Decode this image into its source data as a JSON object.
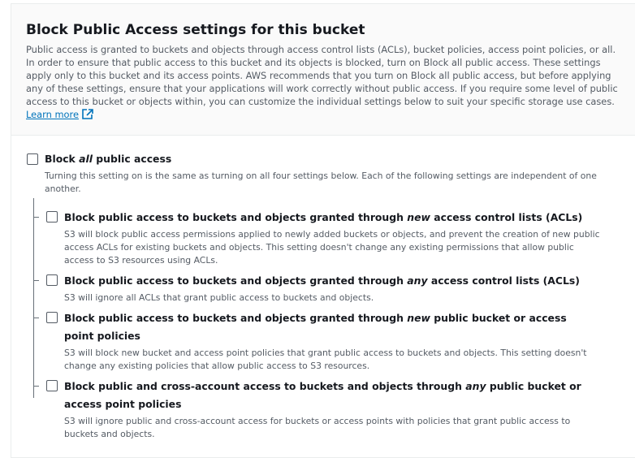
{
  "section": {
    "title": "Block Public Access settings for this bucket",
    "description": "Public access is granted to buckets and objects through access control lists (ACLs), bucket policies, access point policies, or all. In order to ensure that public access to this bucket and its objects is blocked, turn on Block all public access. These settings apply only to this bucket and its access points. AWS recommends that you turn on Block all public access, but before applying any of these settings, ensure that your applications will work correctly without public access. If you require some level of public access to this bucket or objects within, you can customize the individual settings below to suit your specific storage use cases.",
    "learn_more": "Learn more"
  },
  "block_all": {
    "label_pre": "Block ",
    "label_em": "all",
    "label_post": " public access",
    "description": "Turning this setting on is the same as turning on all four settings below. Each of the following settings are independent of one another.",
    "checked": false
  },
  "options": [
    {
      "label_pre": "Block public access to buckets and objects granted through ",
      "label_em": "new",
      "label_post": " access control lists (ACLs)",
      "description": "S3 will block public access permissions applied to newly added buckets or objects, and prevent the creation of new public access ACLs for existing buckets and objects. This setting doesn't change any existing permissions that allow public access to S3 resources using ACLs.",
      "checked": false
    },
    {
      "label_pre": "Block public access to buckets and objects granted through ",
      "label_em": "any",
      "label_post": " access control lists (ACLs)",
      "description": "S3 will ignore all ACLs that grant public access to buckets and objects.",
      "checked": false
    },
    {
      "label_pre": "Block public access to buckets and objects granted through ",
      "label_em": "new",
      "label_post": " public bucket or access point policies",
      "description": "S3 will block new bucket and access point policies that grant public access to buckets and objects. This setting doesn't change any existing policies that allow public access to S3 resources.",
      "checked": false
    },
    {
      "label_pre": "Block public and cross-account access to buckets and objects through ",
      "label_em": "any",
      "label_post": " public bucket or access point policies",
      "description": "S3 will ignore public and cross-account access for buckets or access points with policies that grant public access to buckets and objects.",
      "checked": false
    }
  ],
  "colors": {
    "link": "#0073bb",
    "text": "#16191f",
    "muted": "#545b64"
  }
}
